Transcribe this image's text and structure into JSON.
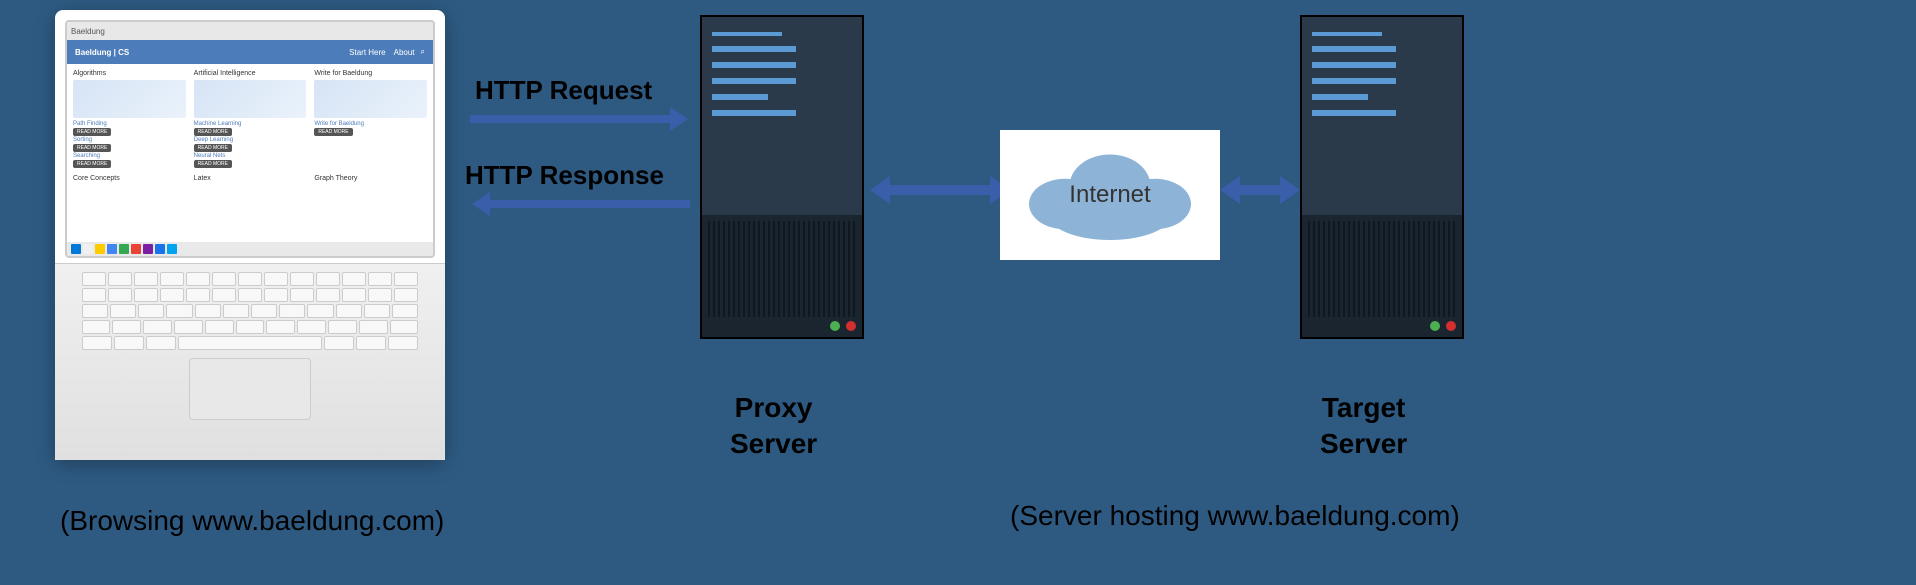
{
  "laptop": {
    "browser_tab": "Baeldung",
    "header_brand": "Baeldung | CS",
    "nav1": "Start Here",
    "nav2": "About",
    "cols": [
      {
        "title": "Algorithms",
        "link": "Path Finding",
        "sub1": "Sorting",
        "sub2": "Searching"
      },
      {
        "title": "Artificial Intelligence",
        "link": "Machine Learning",
        "sub1": "Deep Learning",
        "sub2": "Neural Nets"
      },
      {
        "title": "Write for Baeldung",
        "link": "Write for Baeldung",
        "sub1": "",
        "sub2": ""
      }
    ],
    "row2": [
      "Core Concepts",
      "Latex",
      "Graph Theory"
    ],
    "btn": "READ MORE"
  },
  "arrows": {
    "request": "HTTP Request",
    "response": "HTTP Response"
  },
  "cloud": {
    "label": "Internet"
  },
  "proxy": {
    "label_l1": "Proxy",
    "label_l2": "Server"
  },
  "target": {
    "label_l1": "Target",
    "label_l2": "Server"
  },
  "captions": {
    "client": "(Browsing www.baeldung.com)",
    "server": "(Server hosting www.baeldung.com)"
  }
}
